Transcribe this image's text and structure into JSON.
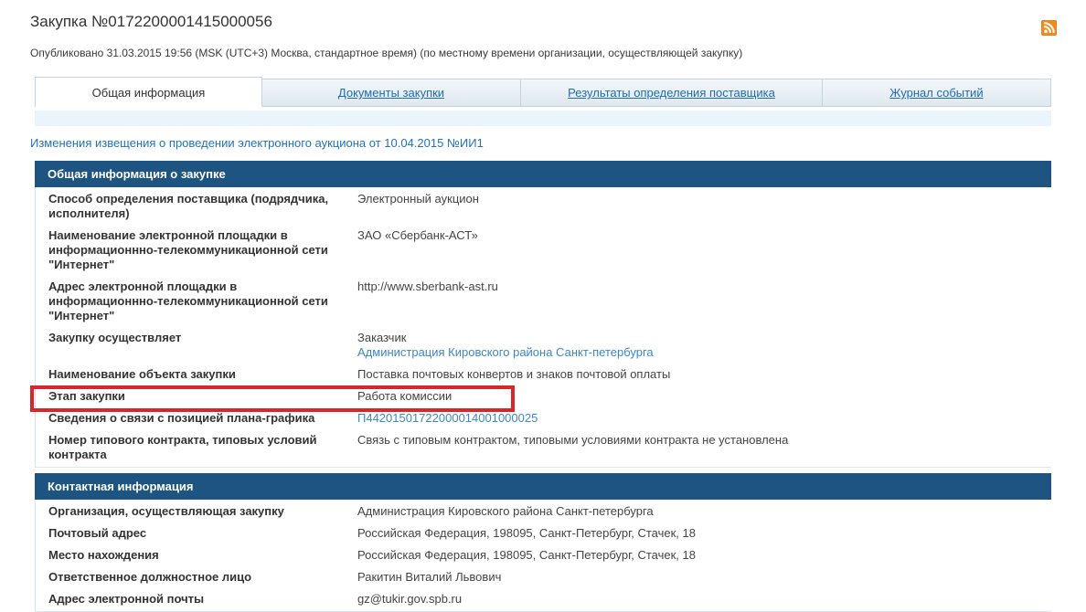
{
  "header": {
    "title": "Закупка №0172200001415000056",
    "published": "Опубликовано 31.03.2015 19:56 (MSK (UTC+3) Москва, стандартное время) (по местному времени организации, осуществляющей закупку)"
  },
  "tabs": [
    {
      "label": "Общая информация",
      "active": true
    },
    {
      "label": "Документы закупки",
      "active": false
    },
    {
      "label": "Результаты определения поставщика",
      "active": false
    },
    {
      "label": "Журнал событий",
      "active": false
    }
  ],
  "amendment_link": "Изменения извещения о проведении электронного аукциона от 10.04.2015 №ИИ1",
  "general_section": {
    "title": "Общая информация о закупке",
    "rows": [
      {
        "label": "Способ определения поставщика (подрядчика, исполнителя)",
        "value": "Электронный аукцион"
      },
      {
        "label": "Наименование электронной площадки в информационнно-телекоммуникационной сети \"Интернет\"",
        "value": "ЗАО «Сбербанк-АСТ»"
      },
      {
        "label": "Адрес электронной площадки в информационнно-телекоммуникационной сети \"Интернет\"",
        "value": "http://www.sberbank-ast.ru"
      },
      {
        "label": "Закупку осуществляет",
        "value": "Заказчик",
        "value_link": "Администрация Кировского района Санкт-петербурга"
      },
      {
        "label": "Наименование объекта закупки",
        "value": "Поставка почтовых конвертов и знаков почтовой оплаты"
      },
      {
        "label": "Этап закупки",
        "value": "Работа комиссии",
        "highlighted": true
      },
      {
        "label": "Сведения о связи с позицией плана-графика",
        "value_link": "П44201501722000014001000025"
      },
      {
        "label": "Номер типового контракта, типовых условий контракта",
        "value": "Связь с типовым контрактом, типовыми условиями контракта не установлена"
      }
    ]
  },
  "contact_section": {
    "title": "Контактная информация",
    "rows": [
      {
        "label": "Организация, осуществляющая закупку",
        "value": "Администрация Кировского района Санкт-петербурга"
      },
      {
        "label": "Почтовый адрес",
        "value": "Российская Федерация, 198095, Санкт-Петербург, Стачек, 18"
      },
      {
        "label": "Место нахождения",
        "value": "Российская Федерация, 198095, Санкт-Петербург, Стачек, 18"
      },
      {
        "label": "Ответственное должностное лицо",
        "value": "Ракитин Виталий Львович"
      },
      {
        "label": "Адрес электронной почты",
        "value": "gz@tukir.gov.spb.ru"
      }
    ]
  },
  "icons": {
    "rss": "rss-feed-icon"
  },
  "colors": {
    "section_header_bg": "#1e5481",
    "tab_link": "#1f6cb5",
    "amendment_link": "#2273b8",
    "value_link": "#3d87c4",
    "highlight_border": "#d9252b",
    "rss_orange": "#f08b1d",
    "tab_strip_bg": "#e9f4fc"
  }
}
